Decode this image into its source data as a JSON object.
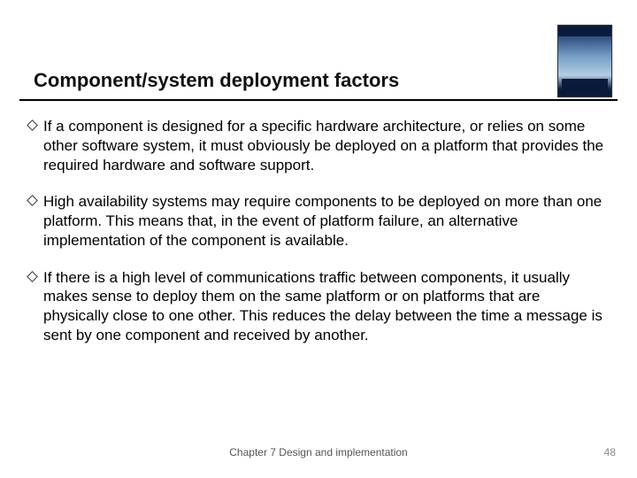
{
  "slide": {
    "title": "Component/system deployment factors",
    "bullets": [
      "If a component is designed for a specific hardware architecture, or relies on some other software system, it must obviously be deployed on a platform that provides the required hardware and software support.",
      "High availability systems may require components to be deployed on more than one platform. This means that, in the event of platform failure, an alternative implementation of the component is available.",
      "If there is a high level of communications traffic between components, it usually makes sense to deploy them on the same platform or on platforms that are physically close to one other. This reduces the delay between the time a message is sent by one component and received by another."
    ],
    "footer_center": "Chapter 7 Design and implementation",
    "page_number": "48"
  }
}
